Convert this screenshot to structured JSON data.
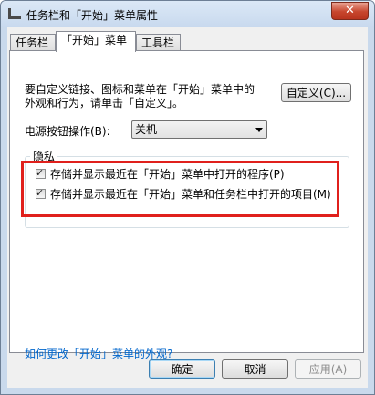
{
  "window": {
    "title": "任务栏和「开始」菜单属性",
    "close_symbol": "✕"
  },
  "tabs": [
    {
      "label": "任务栏",
      "active": false
    },
    {
      "label": "「开始」菜单",
      "active": true
    },
    {
      "label": "工具栏",
      "active": false
    }
  ],
  "main": {
    "description_line1": "要自定义链接、图标和菜单在「开始」菜单中的",
    "description_line2": "外观和行为，请单击「自定义」。",
    "customize_button": "自定义(C)...",
    "power_label": "电源按钮操作(B):",
    "power_select_value": "关机",
    "privacy_title": "隐私",
    "privacy_items": [
      {
        "label": "存储并显示最近在「开始」菜单中打开的程序(P)",
        "checked": true
      },
      {
        "label": "存储并显示最近在「开始」菜单和任务栏中打开的项目(M)",
        "checked": true
      }
    ],
    "help_link": "如何更改「开始」菜单的外观?"
  },
  "footer": {
    "ok": "确定",
    "cancel": "取消",
    "apply": "应用(A)"
  },
  "colors": {
    "highlight": "#e0201c",
    "link": "#0066cc",
    "close_button": "#c7452d"
  }
}
